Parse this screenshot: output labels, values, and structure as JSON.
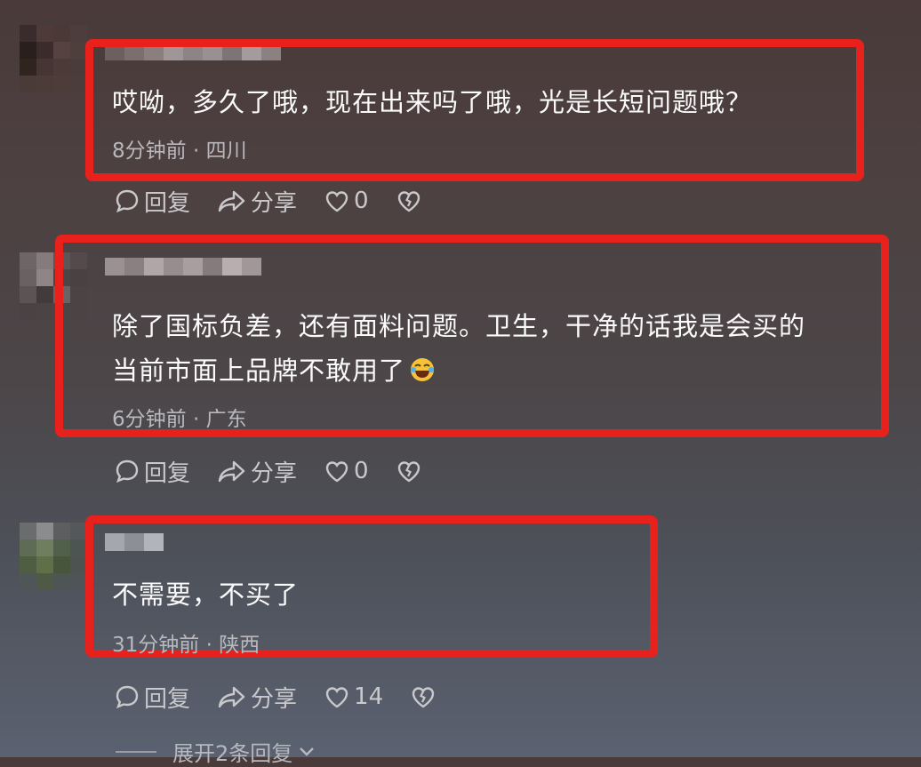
{
  "comments": [
    {
      "text_lines": [
        "哎呦，多久了哦，现在出来吗了哦，光是长短问题哦？"
      ],
      "time": "8分钟前",
      "location": "四川",
      "reply_label": "回复",
      "share_label": "分享",
      "like_count": "0"
    },
    {
      "text_lines": [
        "除了国标负差，还有面料问题。卫生，干净的话我是会买的",
        "当前市面上品牌不敢用了"
      ],
      "emoji": "rolling-on-floor-laughing",
      "time": "6分钟前",
      "location": "广东",
      "reply_label": "回复",
      "share_label": "分享",
      "like_count": "0"
    },
    {
      "text_lines": [
        "不需要，不买了"
      ],
      "time": "31分钟前",
      "location": "陕西",
      "reply_label": "回复",
      "share_label": "分享",
      "like_count": "14"
    }
  ],
  "expand_replies": "展开2条回复",
  "colors": {
    "highlight": "#e8211c",
    "text": "#fbfbfb",
    "meta": "#b9b9bd"
  },
  "icons": [
    "comment-bubble-icon",
    "share-arrow-icon",
    "heart-icon",
    "broken-heart-icon",
    "chevron-down-icon"
  ]
}
